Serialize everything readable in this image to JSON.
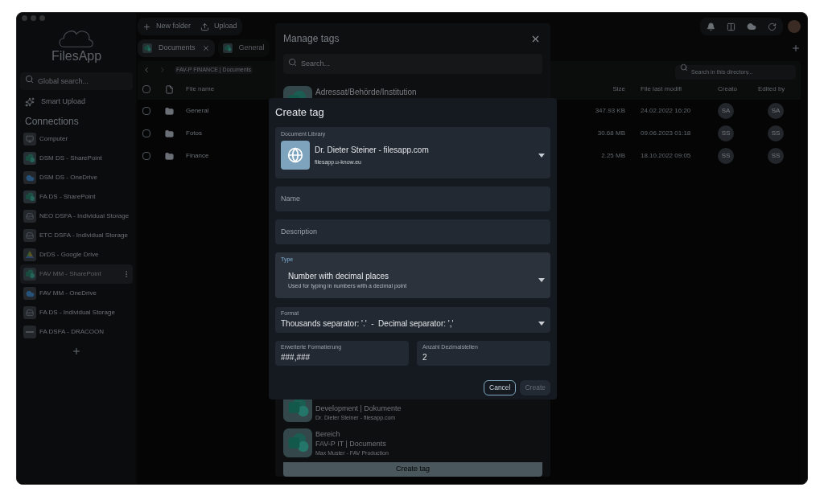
{
  "sidebar": {
    "app_name": "FilesApp",
    "search": {
      "placeholder": "Global search..."
    },
    "smart_upload": "Smart Upload",
    "connections_title": "Connections",
    "items": [
      {
        "label": "Computer",
        "kind": "computer",
        "selected": false
      },
      {
        "label": "DSM DS - SharePoint",
        "kind": "sharepoint",
        "selected": false
      },
      {
        "label": "DSM DS - OneDrive",
        "kind": "onedrive",
        "selected": false
      },
      {
        "label": "FA DS - SharePoint",
        "kind": "sharepoint",
        "selected": false
      },
      {
        "label": "NEO DSFA - Individual Storage",
        "kind": "storage",
        "selected": false
      },
      {
        "label": "ETC DSFA - Individual Storage",
        "kind": "storage",
        "selected": false
      },
      {
        "label": "DrDS - Google Drive",
        "kind": "google",
        "selected": false
      },
      {
        "label": "FAV MM - SharePoint",
        "kind": "sharepoint",
        "selected": true
      },
      {
        "label": "FAV MM - OneDrive",
        "kind": "onedrive",
        "selected": false
      },
      {
        "label": "FA DS - Individual Storage",
        "kind": "storage",
        "selected": false
      },
      {
        "label": "FA DSFA - DRACOON",
        "kind": "dracoon",
        "selected": false
      }
    ]
  },
  "toolbar": [
    "New folder",
    "Upload"
  ],
  "tabs": [
    {
      "label": "Documents",
      "selected": true
    },
    {
      "label": "General",
      "selected": false
    }
  ],
  "breadcrumb": "FAV-P FINANCE | Documents",
  "directory_search": {
    "placeholder": "Search in this directory..."
  },
  "table": {
    "select_all_checked": false,
    "columns": [
      "File name",
      "Size",
      "File last modifi",
      "Creato",
      "Edited by"
    ],
    "rows": [
      {
        "checked": false,
        "name": "General",
        "size": "347.93 KB",
        "modified": "24.02.2022 16:20",
        "creator": "SA",
        "editor": "SA"
      },
      {
        "checked": false,
        "name": "Fotos",
        "size": "30.68 MB",
        "modified": "09.06.2023 01:18",
        "creator": "SS",
        "editor": "SS"
      },
      {
        "checked": false,
        "name": "Finance",
        "size": "2.25 MB",
        "modified": "18.10.2022 09:05",
        "creator": "SS",
        "editor": "SS"
      }
    ]
  },
  "manage_tags": {
    "title": "Manage tags",
    "search": {
      "placeholder": "Search..."
    },
    "top_item": {
      "title": "Adressat/Behörde/Institution"
    },
    "items": [
      {
        "lines": [
          "Development | Dokumente",
          "Dr. Dieter Steiner - filesapp.com"
        ]
      },
      {
        "lines": [
          "Bereich",
          "FAV-P IT | Documents",
          "Max Muster - FAV Production"
        ]
      }
    ],
    "create_button": "Create tag"
  },
  "create_tag": {
    "title": "Create tag",
    "document_library": {
      "label": "Document Library",
      "name": "Dr. Dieter Steiner - filesapp.com",
      "host": "filesapp.u-know.eu"
    },
    "name": {
      "placeholder": "Name"
    },
    "description": {
      "placeholder": "Description"
    },
    "type": {
      "label": "Type",
      "value": "Number with decimal places",
      "hint": "Used for typing in numbers with a decimal point"
    },
    "format": {
      "label": "Format",
      "value": "Thousands separator: '.'  -  Decimal separator: ','"
    },
    "advanced_format": {
      "label": "Erweiterte Formatierung",
      "value": "###,###"
    },
    "decimals": {
      "label": "Anzahl Dezimalstellen",
      "value": "2"
    },
    "buttons": [
      {
        "label": "Cancel",
        "kind": "outline",
        "disabled": false
      },
      {
        "label": "Create",
        "kind": "filled",
        "disabled": true
      }
    ]
  }
}
